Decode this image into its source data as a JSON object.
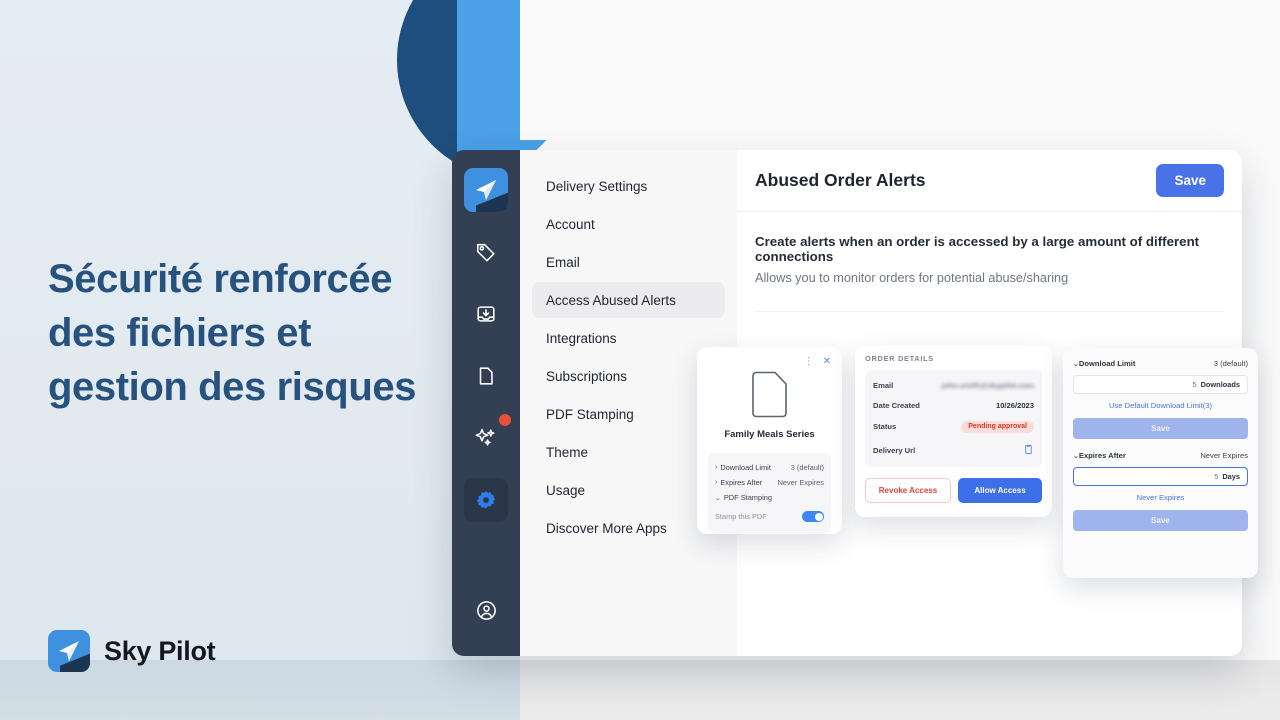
{
  "hero": {
    "headline_lines": [
      "Sécurité renforcée",
      "des fichiers et",
      "gestion des risques"
    ],
    "brand_name": "Sky Pilot",
    "brand_icon": "paper-plane-icon",
    "accent_dark": "#1d4e7e",
    "accent_light": "#4ba0e8",
    "headline_color": "#27527d"
  },
  "rail": {
    "items": [
      {
        "icon": "sky-pilot-logo-icon",
        "name": "logo"
      },
      {
        "icon": "tag-icon",
        "name": "products"
      },
      {
        "icon": "inbox-download-icon",
        "name": "orders"
      },
      {
        "icon": "file-icon",
        "name": "files"
      },
      {
        "icon": "sparkles-icon",
        "name": "whats-new",
        "badge": true
      },
      {
        "icon": "gear-icon",
        "name": "settings",
        "active": true
      },
      {
        "icon": "user-circle-icon",
        "name": "account"
      }
    ]
  },
  "nav": {
    "items": [
      {
        "label": "Delivery Settings",
        "active": false
      },
      {
        "label": "Account",
        "active": false
      },
      {
        "label": "Email",
        "active": false
      },
      {
        "label": "Access Abused Alerts",
        "active": true
      },
      {
        "label": "Integrations",
        "active": false
      },
      {
        "label": "Subscriptions",
        "active": false
      },
      {
        "label": "PDF Stamping",
        "active": false
      },
      {
        "label": "Theme",
        "active": false
      },
      {
        "label": "Usage",
        "active": false
      },
      {
        "label": "Discover More Apps",
        "active": false
      }
    ]
  },
  "main": {
    "title": "Abused Order Alerts",
    "save_label": "Save",
    "save_color": "#4a72e8",
    "description_strong": "Create alerts when an order is accessed by a large amount of different connections",
    "description_sub": "Allows you to monitor orders for potential abuse/sharing"
  },
  "card_file": {
    "menu_icon": "kebab-menu-icon",
    "close_icon": "close-icon",
    "doc_icon": "document-icon",
    "file_name": "Family Meals Series",
    "rows": [
      {
        "label": "Download Limit",
        "value": "3 (default)",
        "chevron": "›"
      },
      {
        "label": "Expires After",
        "value": "Never Expires",
        "chevron": "›"
      },
      {
        "label": "PDF Stamping",
        "value": "",
        "chevron": "⌄"
      }
    ],
    "stamp_label": "Stamp this PDF",
    "stamp_on": true,
    "toggle_color": "#3d86f5"
  },
  "card_order": {
    "title": "ORDER DETAILS",
    "rows": [
      {
        "label": "Email",
        "value": "john.smith@skypilot.com",
        "type": "blurred"
      },
      {
        "label": "Date Created",
        "value": "10/26/2023",
        "type": "text"
      },
      {
        "label": "Status",
        "value": "Pending approval",
        "type": "badge"
      },
      {
        "label": "Delivery Url",
        "value": "",
        "type": "copy-icon"
      }
    ],
    "revoke_label": "Revoke Access",
    "allow_label": "Allow Access",
    "badge_color": "#d4382c",
    "allow_color": "#3d6fe8"
  },
  "card_limits": {
    "download": {
      "label": "Download Limit",
      "value": "3 (default)",
      "chevron": "⌄",
      "input_value": "5",
      "input_unit": "Downloads",
      "link": "Use Default Download Limit(3)",
      "save_label": "Save"
    },
    "expires": {
      "label": "Expires After",
      "value": "Never Expires",
      "chevron": "⌄",
      "input_value": "5",
      "input_unit": "Days",
      "link": "Never Expires",
      "save_label": "Save"
    }
  }
}
